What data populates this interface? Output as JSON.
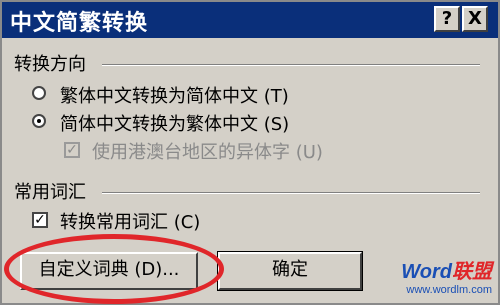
{
  "window": {
    "title": "中文简繁转换",
    "help_glyph": "?",
    "close_glyph": "X"
  },
  "direction_group": {
    "title": "转换方向",
    "options": [
      {
        "label": "繁体中文转换为简体中文 (T)",
        "selected": false
      },
      {
        "label": "简体中文转换为繁体中文 (S)",
        "selected": true
      }
    ],
    "variant_checkbox": {
      "label": "使用港澳台地区的异体字 (U)",
      "checked": true,
      "enabled": false
    }
  },
  "vocab_group": {
    "title": "常用词汇",
    "checkbox": {
      "label": "转换常用词汇 (C)",
      "checked": true
    }
  },
  "buttons": {
    "custom_dict": "自定义词典 (D)...",
    "ok": "确定"
  },
  "watermark": {
    "logo_left": "Word",
    "logo_right": "联盟",
    "url": "www.wordlm.com"
  },
  "colors": {
    "titlebar": "#0a2f7a",
    "dialog_bg": "#d4d0c8",
    "annotation_red": "#e0262a"
  }
}
